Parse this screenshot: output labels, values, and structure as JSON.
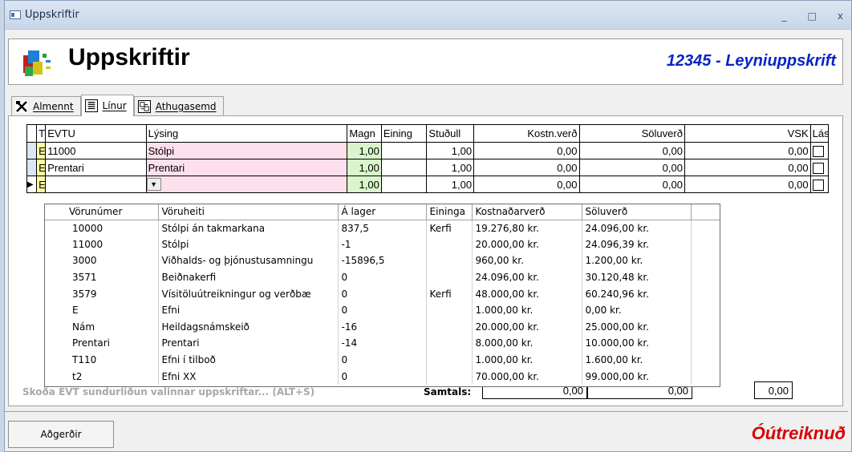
{
  "window": {
    "title": "Uppskriftir",
    "minimize": "_",
    "maximize": "□",
    "close": "x"
  },
  "header": {
    "app_title": "Uppskriftir",
    "record_title": "12345 - Leyniuppskrift"
  },
  "tabs": [
    {
      "label": "Almennt",
      "icon": "tools-icon"
    },
    {
      "label": "Línur",
      "icon": "lines-icon",
      "active": true
    },
    {
      "label": "Athugasemd",
      "icon": "note-icon"
    }
  ],
  "grid": {
    "headers": {
      "t": "T",
      "evtu": "EVTU",
      "lysing": "Lýsing",
      "magn": "Magn",
      "eining": "Eining",
      "studull": "Stuðull",
      "kostn": "Kostn.verð",
      "soluverd": "Söluverð",
      "vsk": "VSK",
      "las": "Lás"
    },
    "rows": [
      {
        "t": "E",
        "evtu": "11000",
        "lysing": "Stólpi",
        "magn": "1,00",
        "eining": "",
        "studull": "1,00",
        "kostn": "0,00",
        "soluverd": "0,00",
        "vsk": "0,00"
      },
      {
        "t": "E",
        "evtu": "Prentari",
        "lysing": "Prentari",
        "magn": "1,00",
        "eining": "",
        "studull": "1,00",
        "kostn": "0,00",
        "soluverd": "0,00",
        "vsk": "0,00"
      },
      {
        "t": "E",
        "evtu": "",
        "lysing": "",
        "magn": "1,00",
        "eining": "",
        "studull": "1,00",
        "kostn": "0,00",
        "soluverd": "0,00",
        "vsk": "0,00",
        "current": true
      }
    ]
  },
  "dropdown": {
    "headers": {
      "vorunumer": "Vörunúmer",
      "voruheiti": "Vöruheiti",
      "lager": "Á lager",
      "eining": "Eininga",
      "kostn": "Kostnaðarverð",
      "soluverd": "Söluverð"
    },
    "items": [
      {
        "vorunumer": "10000",
        "voruheiti": "Stólpi án takmarkana",
        "lager": "837,5",
        "eining": "Kerfi",
        "kostn": "19.276,80 kr.",
        "soluverd": "24.096,00 kr."
      },
      {
        "vorunumer": "11000",
        "voruheiti": "Stólpi",
        "lager": "-1",
        "eining": "",
        "kostn": "20.000,00 kr.",
        "soluverd": "24.096,39 kr."
      },
      {
        "vorunumer": "3000",
        "voruheiti": "Viðhalds- og þjónustusamningu",
        "lager": "-15896,5",
        "eining": "",
        "kostn": "960,00 kr.",
        "soluverd": "1.200,00 kr."
      },
      {
        "vorunumer": "3571",
        "voruheiti": "Beiðnakerfi",
        "lager": "0",
        "eining": "",
        "kostn": "24.096,00 kr.",
        "soluverd": "30.120,48 kr."
      },
      {
        "vorunumer": "3579",
        "voruheiti": "Vísitöluútreikningur og verðbæ",
        "lager": "0",
        "eining": "Kerfi",
        "kostn": "48.000,00 kr.",
        "soluverd": "60.240,96 kr."
      },
      {
        "vorunumer": "E",
        "voruheiti": "Efni",
        "lager": "0",
        "eining": "",
        "kostn": "1.000,00 kr.",
        "soluverd": "0,00 kr."
      },
      {
        "vorunumer": "Nám",
        "voruheiti": "Heildagsnámskeið",
        "lager": "-16",
        "eining": "",
        "kostn": "20.000,00 kr.",
        "soluverd": "25.000,00 kr."
      },
      {
        "vorunumer": "Prentari",
        "voruheiti": "Prentari",
        "lager": "-14",
        "eining": "",
        "kostn": "8.000,00 kr.",
        "soluverd": "10.000,00 kr."
      },
      {
        "vorunumer": "T110",
        "voruheiti": "Efni í tilboð",
        "lager": "0",
        "eining": "",
        "kostn": "1.000,00 kr.",
        "soluverd": "1.600,00 kr."
      },
      {
        "vorunumer": "t2",
        "voruheiti": "Efni XX",
        "lager": "0",
        "eining": "",
        "kostn": "70.000,00 kr.",
        "soluverd": "99.000,00 kr."
      }
    ]
  },
  "footer": {
    "hint": "Skoða EVT sundurliðun valinnar uppskriftar... (ALT+S)",
    "total_label": "Samtals:",
    "total_kostn": "0,00",
    "total_soluverd": "0,00",
    "total_vsk": "0,00"
  },
  "actions": {
    "button_label": "Aðgerðir",
    "status": "Óútreiknuð"
  },
  "colors": {
    "record_title": "#0a23c8",
    "status": "#d80000",
    "evtu_type": "#fffca0",
    "lysing_bg": "#fde0ec",
    "magn_bg": "#d9f5cc"
  }
}
